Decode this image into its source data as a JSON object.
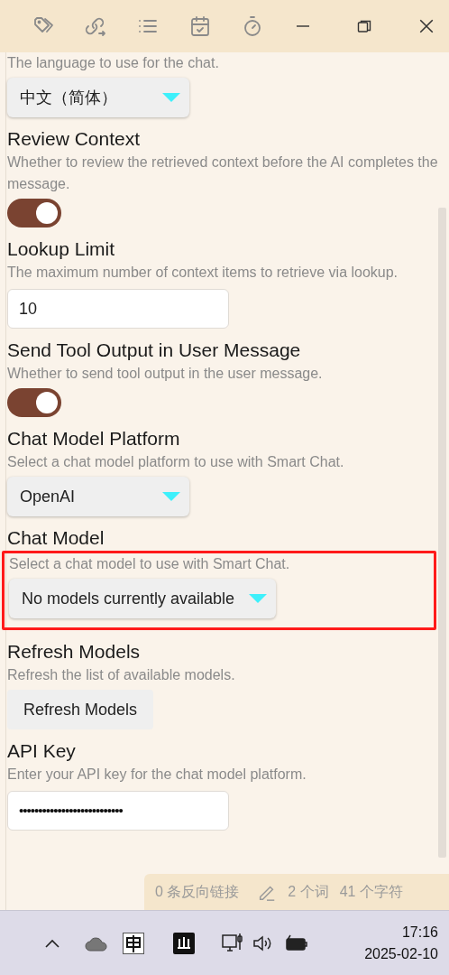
{
  "settings": [
    {
      "kind": "dropdown",
      "description": "The language to use for the chat.",
      "value": "中文（简体）"
    },
    {
      "kind": "toggle",
      "title": "Review Context",
      "description": "Whether to review the retrieved context before the AI completes the message.",
      "on": true
    },
    {
      "kind": "text",
      "title": "Lookup Limit",
      "description": "The maximum number of context items to retrieve via lookup.",
      "value": "10"
    },
    {
      "kind": "toggle",
      "title": "Send Tool Output in User Message",
      "description": "Whether to send tool output in the user message.",
      "on": true
    },
    {
      "kind": "dropdown",
      "title": "Chat Model Platform",
      "description": "Select a chat model platform to use with Smart Chat.",
      "value": "OpenAI"
    },
    {
      "kind": "dropdown",
      "title": "Chat Model",
      "description": "Select a chat model to use with Smart Chat.",
      "value": "No models currently available",
      "highlighted": true
    },
    {
      "kind": "button",
      "title": "Refresh Models",
      "description": "Refresh the list of available models.",
      "label": "Refresh Models"
    },
    {
      "kind": "password",
      "title": "API Key",
      "description": "Enter your API key for the chat model platform.",
      "value": "•••••••••••••••••••••••••••"
    }
  ],
  "status_bar": {
    "backlinks": "0 条反向链接",
    "words": "2 个词",
    "chars": "41 个字符"
  },
  "taskbar": {
    "time": "17:16",
    "date": "2025-02-10"
  }
}
